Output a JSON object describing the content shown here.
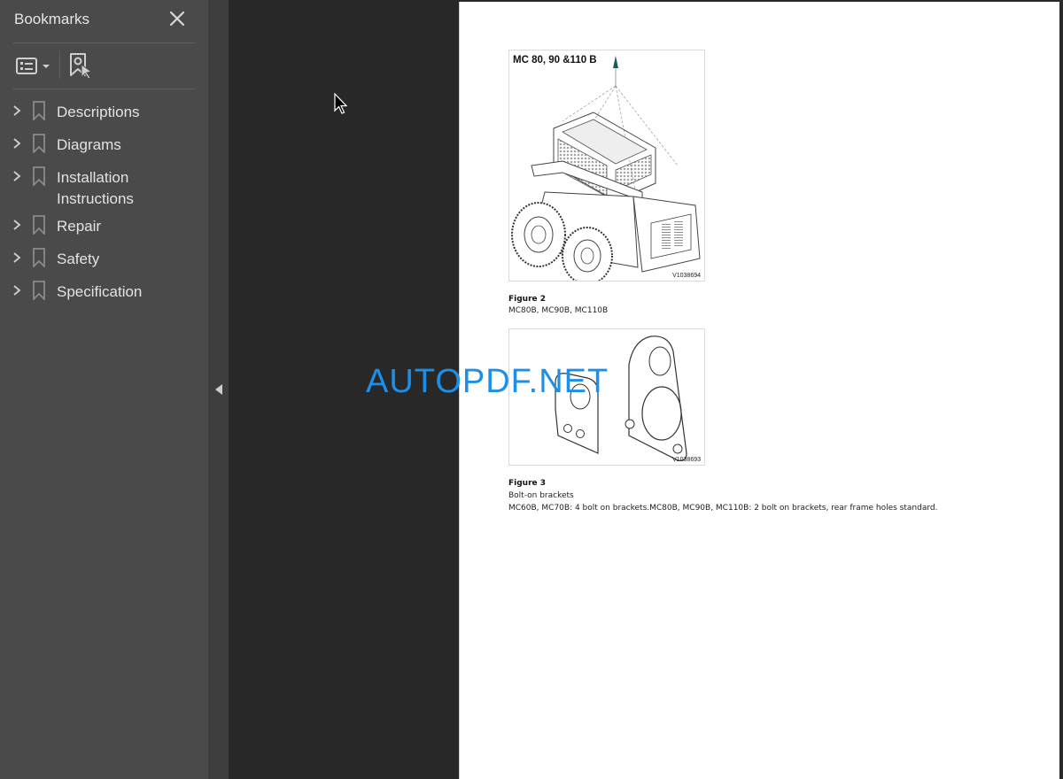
{
  "sidebar": {
    "title": "Bookmarks",
    "close_icon": "close-icon",
    "toolbar": {
      "options_icon": "list-options-icon",
      "find_icon": "find-current-bookmark-icon"
    },
    "items": [
      {
        "label": "Descriptions",
        "expanded": false
      },
      {
        "label": "Diagrams",
        "expanded": false
      },
      {
        "label": "Installation Instructions",
        "expanded": false
      },
      {
        "label": "Repair",
        "expanded": false
      },
      {
        "label": "Safety",
        "expanded": false
      },
      {
        "label": "Specification",
        "expanded": false
      }
    ]
  },
  "collapse_icon": "triangle-left-icon",
  "document": {
    "figure2": {
      "image_title": "MC 80, 90 &110 B",
      "image_id": "V1038694",
      "caption_label": "Figure 2",
      "caption_text": "MC80B, MC90B, MC110B"
    },
    "figure3": {
      "image_id": "V1038693",
      "caption_label": "Figure 3",
      "caption_title": "Bolt-on brackets",
      "caption_text": "MC60B, MC70B: 4 bolt on brackets.MC80B, MC90B, MC110B: 2 bolt on brackets, rear frame holes standard."
    }
  },
  "watermark": "AUTOPDF.NET",
  "colors": {
    "sidebar_bg": "#4a4a4a",
    "doc_bg": "#282828",
    "watermark": "#1e8fe8"
  }
}
